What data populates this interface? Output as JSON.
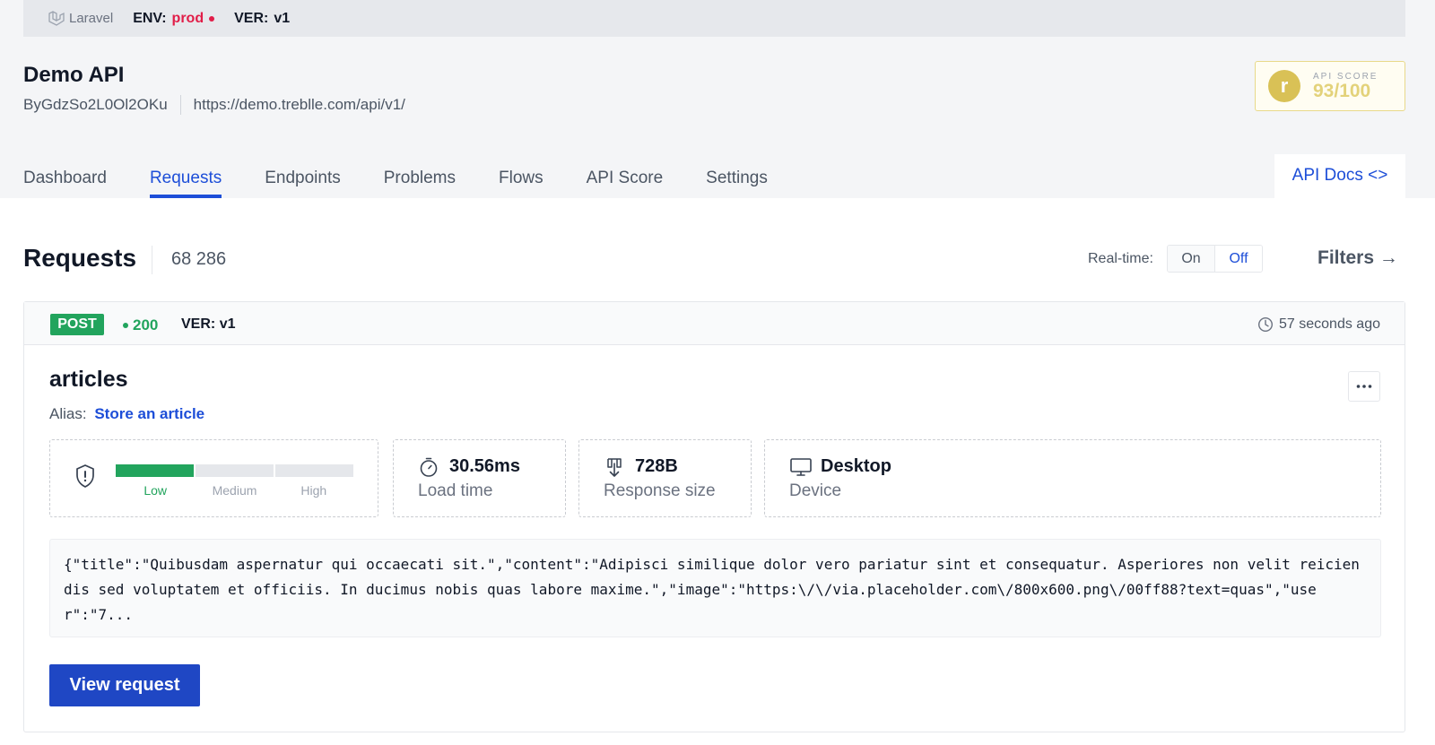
{
  "topbar": {
    "logo_text": "Laravel",
    "env_label": "ENV:",
    "env_value": "prod",
    "ver_label": "VER:",
    "ver_value": "v1",
    "env_color": "#e11d48"
  },
  "api": {
    "title": "Demo API",
    "id": "ByGdzSo2L0Ol2OKu",
    "url": "https://demo.treblle.com/api/v1/"
  },
  "score": {
    "label": "API SCORE",
    "value": "93/100"
  },
  "tabs": [
    {
      "label": "Dashboard",
      "active": false
    },
    {
      "label": "Requests",
      "active": true
    },
    {
      "label": "Endpoints",
      "active": false
    },
    {
      "label": "Problems",
      "active": false
    },
    {
      "label": "Flows",
      "active": false
    },
    {
      "label": "API Score",
      "active": false
    },
    {
      "label": "Settings",
      "active": false
    }
  ],
  "docs_tab": {
    "label": "API Docs <>"
  },
  "requests": {
    "title": "Requests",
    "count": "68 286",
    "realtime_label": "Real-time:",
    "realtime_on": "On",
    "realtime_off": "Off",
    "realtime_selected": "Off",
    "filters_label": "Filters →"
  },
  "card": {
    "method": "POST",
    "status": "200",
    "ver_label": "VER:",
    "ver_value": "v1",
    "time_ago": "57 seconds ago",
    "endpoint": "articles",
    "alias_label": "Alias:",
    "alias_value": "Store an article",
    "risk": {
      "levels": [
        "Low",
        "Medium",
        "High"
      ],
      "current": "Low",
      "icon": "shield-alert-icon"
    },
    "load_time": {
      "value": "30.56ms",
      "label": "Load time",
      "icon": "stopwatch-icon"
    },
    "response_size": {
      "value": "728B",
      "label": "Response size",
      "icon": "download-icon"
    },
    "device": {
      "value": "Desktop",
      "label": "Device",
      "icon": "monitor-icon"
    },
    "payload": "{\"title\":\"Quibusdam aspernatur qui occaecati sit.\",\"content\":\"Adipisci similique dolor vero pariatur sint et consequatur. Asperiores non velit reiciendis sed voluptatem et officiis. In ducimus nobis quas labore maxime.\",\"image\":\"https:\\/\\/via.placeholder.com\\/800x600.png\\/00ff88?text=quas\",\"user\":\"7...",
    "view_button": "View request"
  },
  "colors": {
    "accent": "#1d4ed8",
    "success": "#22a45d",
    "score_gold": "#e3d27a"
  }
}
